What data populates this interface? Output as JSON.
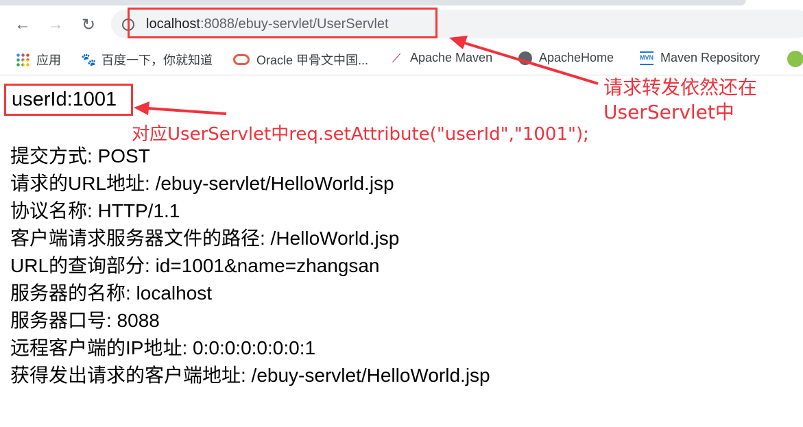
{
  "browser": {
    "url_host": "localhost",
    "url_rest": ":8088/ebuy-servlet/UserServlet",
    "bookmarks": [
      {
        "label": "应用",
        "icon": "apps-grid-icon"
      },
      {
        "label": "百度一下，你就知道",
        "icon": "baidu-paw-icon"
      },
      {
        "label": "Oracle 甲骨文中国...",
        "icon": "oracle-icon"
      },
      {
        "label": "Apache Maven",
        "icon": "apache-feather-icon"
      },
      {
        "label": "ApacheHome",
        "icon": "globe-icon"
      },
      {
        "label": "Maven Repository",
        "icon": "mvn-icon"
      }
    ]
  },
  "page": {
    "user_id": "userId:1001",
    "lines": [
      "提交方式: POST",
      "请求的URL地址: /ebuy-servlet/HelloWorld.jsp",
      "协议名称: HTTP/1.1",
      "客户端请求服务器文件的路径: /HelloWorld.jsp",
      "URL的查询部分: id=1001&name=zhangsan",
      "服务器的名称: localhost",
      "服务器口号: 8088",
      "远程客户端的IP地址: 0:0:0:0:0:0:0:1",
      "获得发出请求的客户端地址: /ebuy-servlet/HelloWorld.jsp"
    ]
  },
  "annotations": {
    "url_note_1": "请求转发依然还在",
    "url_note_2": "UserServlet中",
    "userid_note": "对应UserServlet中req.setAttribute(\"userId\",\"1001\");",
    "color": "#f0323c"
  }
}
